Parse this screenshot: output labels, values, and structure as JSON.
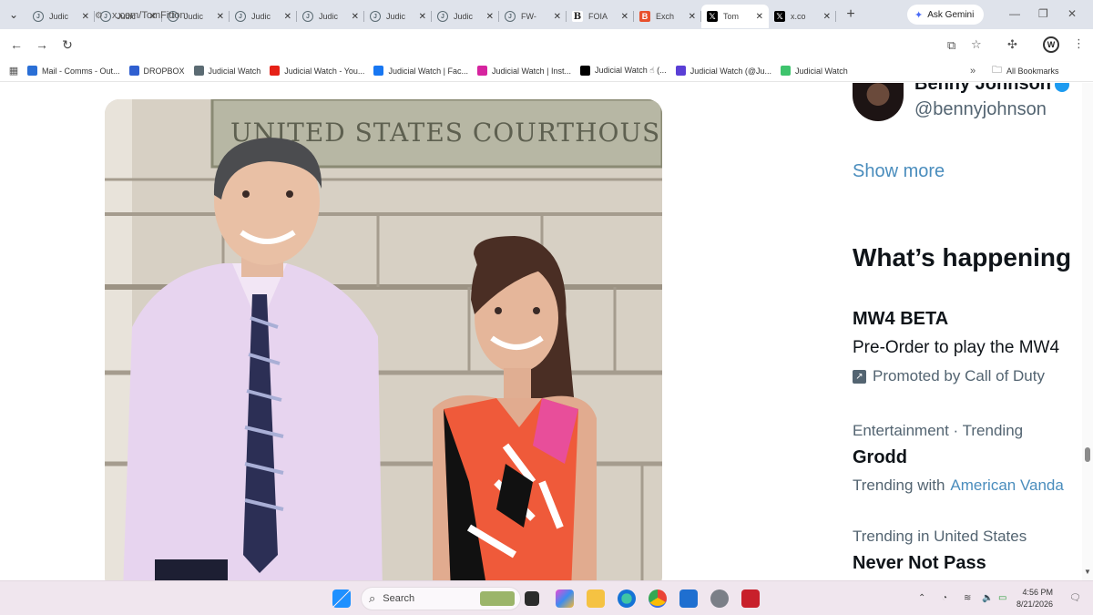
{
  "tabs": [
    {
      "label": "Judic",
      "icon": "judicial-watch-icon"
    },
    {
      "label": "Judic",
      "icon": "judicial-watch-icon"
    },
    {
      "label": "Judic",
      "icon": "judicial-watch-icon"
    },
    {
      "label": "Judic",
      "icon": "judicial-watch-icon"
    },
    {
      "label": "Judic",
      "icon": "judicial-watch-icon"
    },
    {
      "label": "Judic",
      "icon": "judicial-watch-icon"
    },
    {
      "label": "Judic",
      "icon": "judicial-watch-icon"
    },
    {
      "label": "FW-",
      "icon": "judicial-watch-icon"
    },
    {
      "label": "FOIA",
      "icon": "b-icon"
    },
    {
      "label": "Exch",
      "icon": "bor-icon"
    },
    {
      "label": "Tom",
      "icon": "x-icon",
      "active": true
    },
    {
      "label": "x.co",
      "icon": "x-icon"
    }
  ],
  "gemini": {
    "label": "Ask Gemini"
  },
  "address": {
    "url": "x.com/TomFitton"
  },
  "bookmarks": [
    {
      "label": "Mail - Comms - Out...",
      "color": "#2a6fd6"
    },
    {
      "label": "DROPBOX",
      "color": "#2f5fd0"
    },
    {
      "label": "Judicial Watch",
      "color": "#5b6b73"
    },
    {
      "label": "Judicial Watch - You...",
      "color": "#e62117"
    },
    {
      "label": "Judicial Watch | Fac...",
      "color": "#1877f2"
    },
    {
      "label": "Judicial Watch | Inst...",
      "color": "#d6249f"
    },
    {
      "label": "Judicial Watch ☝ (...",
      "color": "#000000"
    },
    {
      "label": "Judicial Watch (@Ju...",
      "color": "#5a3fd6"
    },
    {
      "label": "Judicial Watch",
      "color": "#3ec46d"
    }
  ],
  "all_bookmarks": "All Bookmarks",
  "photo": {
    "sign_text": "UNITED STATES COURTHOUS"
  },
  "sidebar": {
    "follow_name": "Benny Johnson",
    "follow_handle": "@bennyjohnson",
    "show_more": "Show more",
    "section_title": "What’s happening",
    "trends": [
      {
        "title": "MW4 BETA",
        "subtitle": "Pre-Order to play the MW4",
        "meta": "Promoted by Call of Duty"
      },
      {
        "context": "Entertainment · Trending",
        "title": "Grodd",
        "with_label": "Trending with",
        "with_link": "American Vanda"
      },
      {
        "context": "Trending in United States",
        "title": "Never Not Pass"
      }
    ]
  },
  "taskbar": {
    "search_placeholder": "Search",
    "time": "4:56 PM",
    "date": "8/21/2026"
  }
}
